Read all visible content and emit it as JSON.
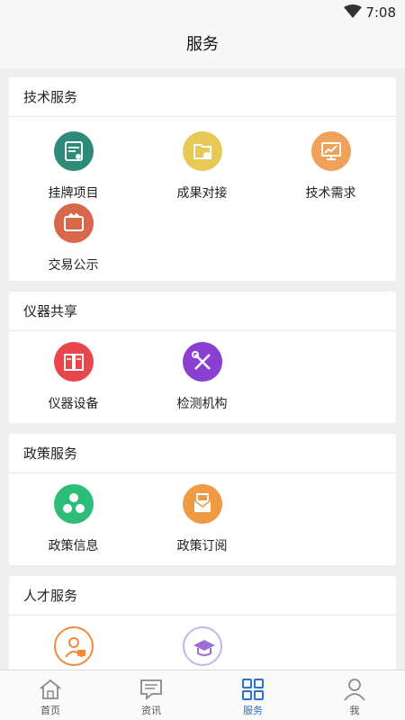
{
  "status": {
    "time": "7:08"
  },
  "header": {
    "title": "服务"
  },
  "sections": [
    {
      "title": "技术服务",
      "items": [
        {
          "label": "挂牌项目",
          "icon": "certificate-icon",
          "color": "#2e8b7a"
        },
        {
          "label": "成果对接",
          "icon": "folder-icon",
          "color": "#e8c957"
        },
        {
          "label": "技术需求",
          "icon": "monitor-chart-icon",
          "color": "#f0a15a"
        },
        {
          "label": "交易公示",
          "icon": "wallet-icon",
          "color": "#d9684a"
        }
      ]
    },
    {
      "title": "仪器共享",
      "items": [
        {
          "label": "仪器设备",
          "icon": "book-icon",
          "color": "#e8454c"
        },
        {
          "label": "检测机构",
          "icon": "tools-icon",
          "color": "#8a3fd1"
        }
      ]
    },
    {
      "title": "政策服务",
      "items": [
        {
          "label": "政策信息",
          "icon": "hexagons-icon",
          "color": "#2dbd79"
        },
        {
          "label": "政策订阅",
          "icon": "envelope-icon",
          "color": "#f19a44"
        }
      ]
    },
    {
      "title": "人才服务",
      "items": [
        {
          "label": "",
          "icon": "person-icon",
          "color": "#f28a3a"
        },
        {
          "label": "",
          "icon": "graduation-cap-icon",
          "color": "#9b6fd6"
        }
      ]
    }
  ],
  "tabs": [
    {
      "label": "首页",
      "icon": "home-icon",
      "active": false
    },
    {
      "label": "资讯",
      "icon": "message-icon",
      "active": false
    },
    {
      "label": "服务",
      "icon": "grid-icon",
      "active": true
    },
    {
      "label": "我",
      "icon": "user-icon",
      "active": false
    }
  ],
  "colors": {
    "accent": "#2a73c9",
    "background": "#efefef"
  }
}
